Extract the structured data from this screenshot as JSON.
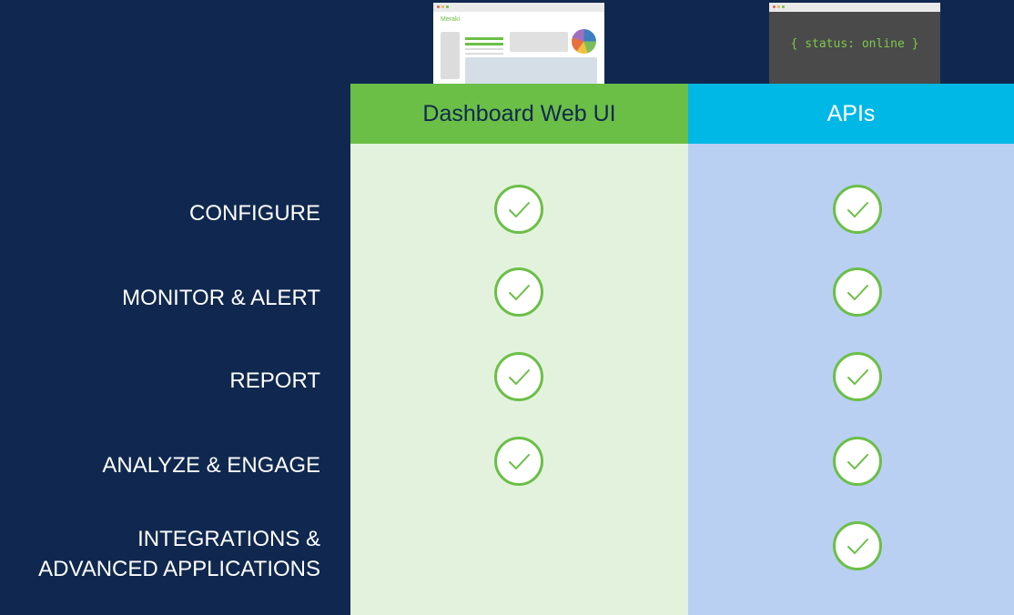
{
  "columns": {
    "web": {
      "label": "Dashboard Web UI",
      "color": "#6bbf47",
      "body_color": "#e3f2dd"
    },
    "api": {
      "label": "APIs",
      "color": "#00b8e6",
      "body_color": "#b9d0f3"
    }
  },
  "thumbnails": {
    "web": {
      "brand": "Meraki"
    },
    "api": {
      "terminal_text": "{ status: online }"
    }
  },
  "rows": [
    {
      "label": "CONFIGURE",
      "web": true,
      "api": true
    },
    {
      "label": "MONITOR & ALERT",
      "web": true,
      "api": true
    },
    {
      "label": "REPORT",
      "web": true,
      "api": true
    },
    {
      "label": "ANALYZE & ENGAGE",
      "web": true,
      "api": true
    },
    {
      "label_line1": "INTEGRATIONS &",
      "label_line2": "ADVANCED APPLICATIONS",
      "web": false,
      "api": true
    }
  ],
  "icons": {
    "check": "check-circle-icon"
  },
  "colors": {
    "background": "#10284f",
    "check": "#6bbf47"
  }
}
